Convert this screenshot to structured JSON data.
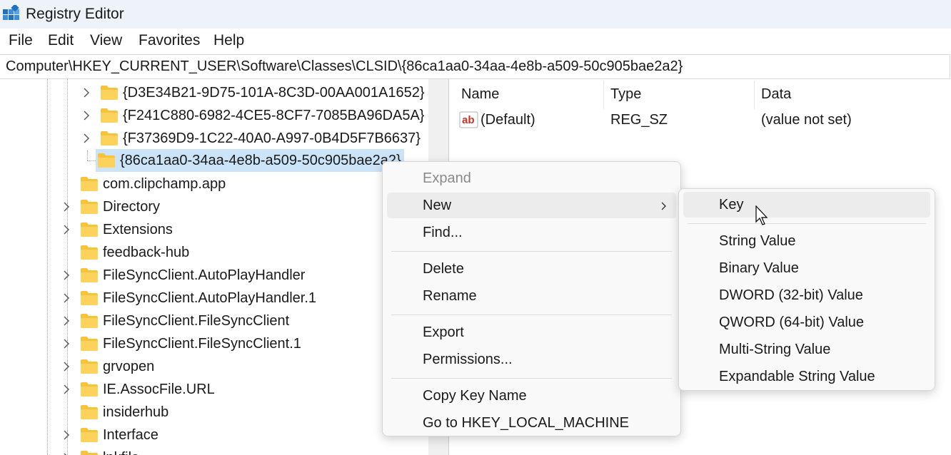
{
  "window": {
    "title": "Registry Editor",
    "icon": "registry-editor-icon"
  },
  "menu": [
    "File",
    "Edit",
    "View",
    "Favorites",
    "Help"
  ],
  "address": "Computer\\HKEY_CURRENT_USER\\Software\\Classes\\CLSID\\{86ca1aa0-34aa-4e8b-a509-50c905bae2a2}",
  "tree": {
    "children": [
      {
        "label": "{D3E34B21-9D75-101A-8C3D-00AA001A1652}",
        "expandable": true
      },
      {
        "label": "{F241C880-6982-4CE5-8CF7-7085BA96DA5A}",
        "expandable": true
      },
      {
        "label": "{F37369D9-1C22-40A0-A997-0B4D5F7B6637}",
        "expandable": true
      },
      {
        "label": "{86ca1aa0-34aa-4e8b-a509-50c905bae2a2}",
        "expandable": false,
        "selected": true
      }
    ],
    "items": [
      {
        "label": "com.clipchamp.app",
        "expandable": false
      },
      {
        "label": "Directory",
        "expandable": true
      },
      {
        "label": "Extensions",
        "expandable": true
      },
      {
        "label": "feedback-hub",
        "expandable": false
      },
      {
        "label": "FileSyncClient.AutoPlayHandler",
        "expandable": true
      },
      {
        "label": "FileSyncClient.AutoPlayHandler.1",
        "expandable": true
      },
      {
        "label": "FileSyncClient.FileSyncClient",
        "expandable": true
      },
      {
        "label": "FileSyncClient.FileSyncClient.1",
        "expandable": true
      },
      {
        "label": "grvopen",
        "expandable": true
      },
      {
        "label": "IE.AssocFile.URL",
        "expandable": true
      },
      {
        "label": "insiderhub",
        "expandable": false
      },
      {
        "label": "Interface",
        "expandable": true
      },
      {
        "label": "lnkfile",
        "expandable": true
      }
    ]
  },
  "values": {
    "columns": [
      "Name",
      "Type",
      "Data"
    ],
    "rows": [
      {
        "icon": "string-value-icon",
        "name": "(Default)",
        "type": "REG_SZ",
        "data": "(value not set)"
      }
    ]
  },
  "context_menu": {
    "items": [
      {
        "label": "Expand",
        "disabled": true
      },
      {
        "label": "New",
        "submenu": true,
        "highlighted": true
      },
      {
        "label": "Find..."
      },
      {
        "separator": true
      },
      {
        "label": "Delete"
      },
      {
        "label": "Rename"
      },
      {
        "separator": true
      },
      {
        "label": "Export"
      },
      {
        "label": "Permissions..."
      },
      {
        "separator": true
      },
      {
        "label": "Copy Key Name"
      },
      {
        "label": "Go to HKEY_LOCAL_MACHINE"
      }
    ]
  },
  "submenu": {
    "items": [
      {
        "label": "Key",
        "highlighted": true
      },
      {
        "separator": true
      },
      {
        "label": "String Value"
      },
      {
        "label": "Binary Value"
      },
      {
        "label": "DWORD (32-bit) Value"
      },
      {
        "label": "QWORD (64-bit) Value"
      },
      {
        "label": "Multi-String Value"
      },
      {
        "label": "Expandable String Value"
      }
    ]
  },
  "colors": {
    "titlebar": "#eef3f9",
    "selection": "#cce4f7",
    "folder": "#f8c33c",
    "menu_highlight": "#ececec"
  }
}
